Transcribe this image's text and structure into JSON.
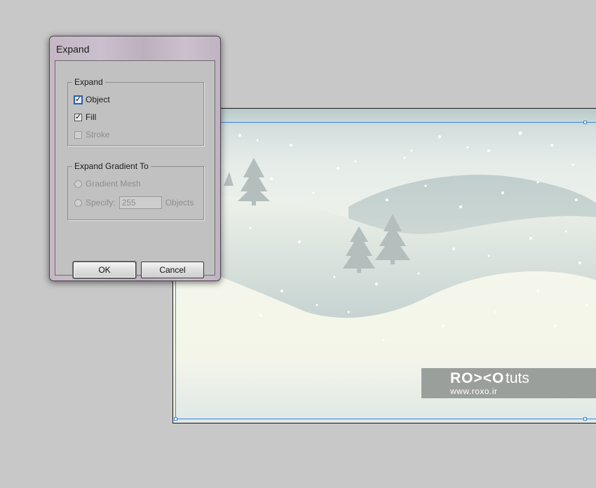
{
  "dialog": {
    "title": "Expand",
    "expand_group": {
      "legend": "Expand",
      "object": {
        "label": "Object",
        "checked": true
      },
      "fill": {
        "label": "Fill",
        "checked": true
      },
      "stroke": {
        "label": "Stroke",
        "checked": false,
        "disabled": true
      }
    },
    "gradient_group": {
      "legend": "Expand Gradient To",
      "gradient_mesh": {
        "label": "Gradient Mesh",
        "disabled": true
      },
      "specify": {
        "label": "Specify:",
        "value": "255",
        "suffix": "Objects",
        "disabled": true
      }
    },
    "ok_label": "OK",
    "cancel_label": "Cancel"
  },
  "watermark": {
    "logo": "RO><O",
    "tuts": "tuts",
    "url": "www.roxo.ir"
  },
  "colors": {
    "canvas_bg": "#c8c8c8",
    "selection": "#3f86e0",
    "dialog_frame": "#c5b7c4",
    "dialog_body": "#c1c1c1"
  }
}
